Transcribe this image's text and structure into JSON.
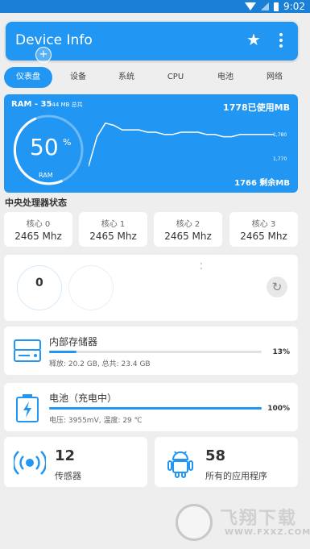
{
  "status_bar": {
    "time": "9:02"
  },
  "app_bar": {
    "title": "Device Info"
  },
  "tabs": [
    {
      "label": "仪表盘",
      "active": true
    },
    {
      "label": "设备"
    },
    {
      "label": "系统"
    },
    {
      "label": "CPU"
    },
    {
      "label": "电池"
    },
    {
      "label": "网络"
    }
  ],
  "ram": {
    "label": "RAM - 35",
    "total_suffix": "44 MB 总共",
    "used": "1778已使用MB",
    "free": "1766 剩余MB",
    "percent": "50",
    "percent_sign": "%",
    "percent_value": 50,
    "gauge_label": "RAM",
    "tick_high": "1,780",
    "tick_low": "1,770",
    "history": [
      1762,
      1775,
      1781,
      1780,
      1778,
      1778,
      1778,
      1777,
      1777,
      1776,
      1776,
      1777,
      1777,
      1777,
      1776,
      1776,
      1775,
      1775,
      1776,
      1776,
      1776,
      1776,
      1776
    ]
  },
  "cpu_section": {
    "title": "中央处理器状态",
    "cores": [
      {
        "name": "核心 0",
        "freq": "2465 Mhz"
      },
      {
        "name": "核心 1",
        "freq": "2465 Mhz"
      },
      {
        "name": "核心 2",
        "freq": "2465 Mhz"
      },
      {
        "name": "核心 3",
        "freq": "2465 Mhz"
      }
    ]
  },
  "blank_card": {
    "value": "0"
  },
  "storage": {
    "title": "内部存储器",
    "detail": "释放: 20.2 GB, 总共: 23.4 GB",
    "percent": "13%",
    "percent_value": 13
  },
  "battery": {
    "title": "电池（充电中）",
    "detail": "电压: 3955mV, 温度: 29 ℃",
    "percent": "100%",
    "percent_value": 100
  },
  "sensors": {
    "count": "12",
    "label": "传感器"
  },
  "apps": {
    "count": "58",
    "label": "所有的应用程序"
  },
  "colors": {
    "accent": "#2196f3",
    "status_bar": "#1a7fd6",
    "background": "#eeeeee"
  },
  "watermark": {
    "brand": "飞翔下载",
    "url": "WWW.FXXZ.COM"
  }
}
